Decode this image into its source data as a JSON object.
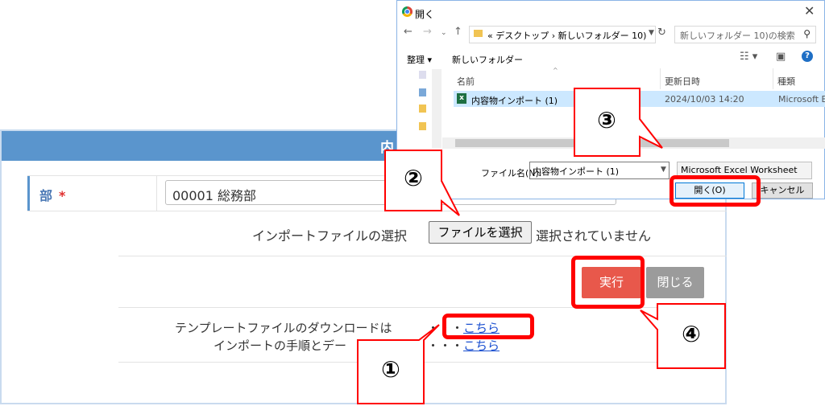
{
  "form": {
    "header_title": "内",
    "dept_label": "部",
    "required_mark": "*",
    "dept_value": "00001 総務部",
    "import_label": "インポートファイルの選択",
    "file_button": "ファイルを選択",
    "no_file_text": "選択されていません",
    "execute_button": "実行",
    "close_button": "閉じる",
    "template_text": "テンプレートファイルのダウンロードは",
    "procedure_text": "インポートの手順とデー",
    "dots1": "・・・",
    "dots2": "・・・",
    "link1": "こちら",
    "link2": "こちら"
  },
  "dialog": {
    "title": "開く",
    "close": "✕",
    "address": "« デスクトップ › 新しいフォルダー 10)",
    "search_placeholder": "新しいフォルダー 10)の検索",
    "organize": "整理 ▾",
    "new_folder": "新しいフォルダー",
    "columns": {
      "name": "名前",
      "date": "更新日時",
      "type": "種類"
    },
    "file": {
      "name": "内容物インポート (1)",
      "date": "2024/10/03 14:20",
      "type": "Microsoft Ex"
    },
    "filename_label": "ファイル名(N):",
    "filename_value": "内容物インポート (1)",
    "filetype_value": "Microsoft Excel Worksheet",
    "open_button": "開く(O)",
    "cancel_button": "キャンセル"
  },
  "callouts": [
    "①",
    "②",
    "③",
    "④"
  ],
  "colors": {
    "annotation_red": "#ff0000",
    "header_blue": "#5a95cd",
    "execute_red": "#e8584b",
    "close_gray": "#9b9b9b"
  }
}
